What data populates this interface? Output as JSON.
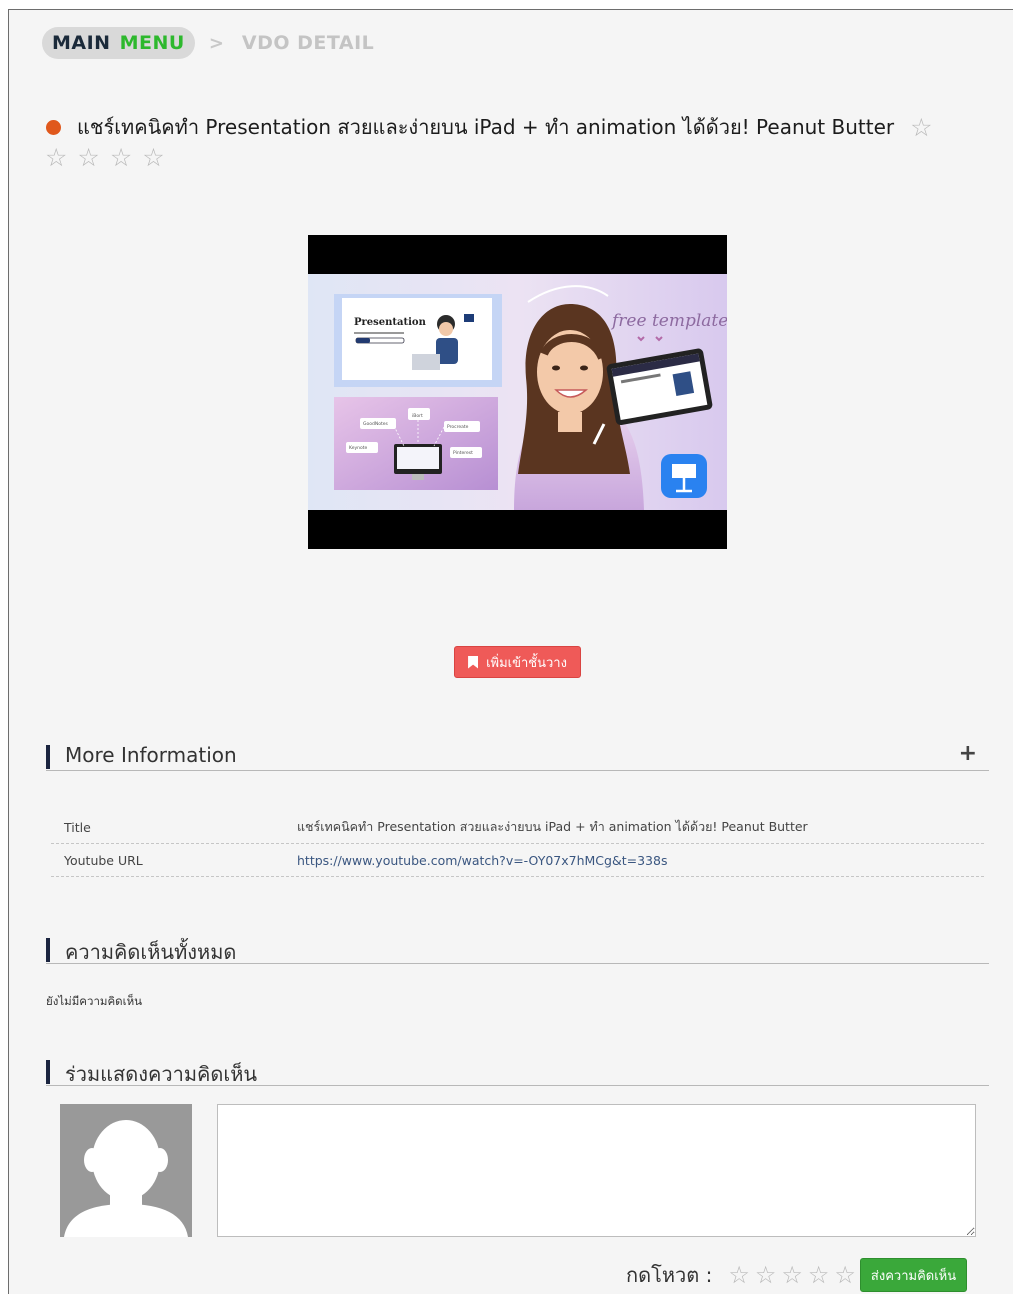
{
  "breadcrumb": {
    "main_word1": "MAIN",
    "main_word2": "MENU",
    "separator": ">",
    "current": "VDO DETAIL"
  },
  "video": {
    "title": "แชร์เทคนิคทำ Presentation สวยและง่ายบน iPad + ทำ animation ได้ด้วย! Peanut Butter",
    "rating": {
      "value": 0,
      "max": 5
    },
    "thumbnail_text": {
      "slide_title": "Presentation",
      "overlay": "free template",
      "apps": [
        "GoodNotes",
        "iBort",
        "Procreate",
        "Keynote",
        "Pinterest"
      ]
    }
  },
  "shelf_button": {
    "label": "เพิ่มเข้าชั้นวาง",
    "icon": "bookmark-icon"
  },
  "more_info": {
    "header": "More Information",
    "expand_icon": "plus-icon",
    "rows": [
      {
        "key": "Title",
        "value": "แชร์เทคนิคทำ Presentation สวยและง่ายบน iPad + ทำ animation ได้ด้วย! Peanut Butter"
      },
      {
        "key": "Youtube URL",
        "value": "https://www.youtube.com/watch?v=-OY07x7hMCg&t=338s"
      }
    ]
  },
  "comments": {
    "header": "ความคิดเห็นทั้งหมด",
    "empty_text": "ยังไม่มีความคิดเห็น"
  },
  "comment_form": {
    "header": "ร่วมแสดงความคิดเห็น",
    "vote_label": "กดโหวต :",
    "vote_max": 5,
    "submit_label": "ส่งความคิดเห็น"
  },
  "colors": {
    "accent_green": "#2db82d",
    "bookmark_red": "#ef5a58",
    "submit_green": "#3aa83a",
    "title_dot": "#e0581c",
    "section_bar": "#1b2540"
  }
}
